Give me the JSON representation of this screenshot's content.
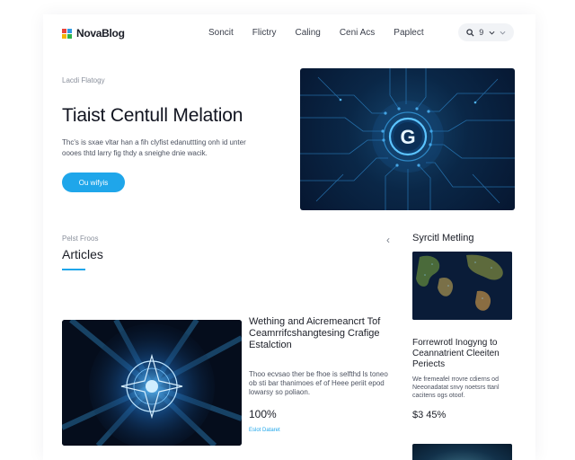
{
  "header": {
    "brand": "NovaBlog",
    "nav": [
      "Soncit",
      "Flictry",
      "Caling",
      "Ceni Acs",
      "Paplect"
    ],
    "search_icon": "search-icon",
    "search_label": "9",
    "chevron_icon": "chevron-down-icon"
  },
  "hero": {
    "breadcrumb": "Lacdi  Flatogy",
    "title": "Tiaist Centull Melation",
    "description": "Thc's is sxae vltar han a fih clyfist edanuttting onh id unter oooes thtd larry fig thdy a sneighe dnie wacik.",
    "cta_label": "Ou wifyis",
    "image_icon": "circuit-core-icon"
  },
  "articles": {
    "label": "Pelst Froos",
    "title": "Articles",
    "prev_label": "‹",
    "featured": {
      "title": "Wething and Aicremeancrt Tof Ceamrrifcshangtesing Crafige Estalction",
      "excerpt": "Thoo ecvsao ther be fhoe is selfthd ls toneo ob sti bar thanimoes ef of Heee periit epod lowarsy so poliaon.",
      "stat": "100%",
      "link": "Eslot Dataret"
    }
  },
  "sidebar": {
    "title": "Syrcitl Metling",
    "card": {
      "title": "Forrewrotl Inogyng to Ceannatrient Cleeiten Periects",
      "excerpt": "We fremeafel rrovre cdierns od Neeonadatat snvy noetsrs ttanl cacitens ogs otoof.",
      "price": "$3 45%"
    }
  },
  "colors": {
    "accent": "#1fa6ea",
    "hero_bg": "#0a2747",
    "text": "#1b1e27"
  }
}
